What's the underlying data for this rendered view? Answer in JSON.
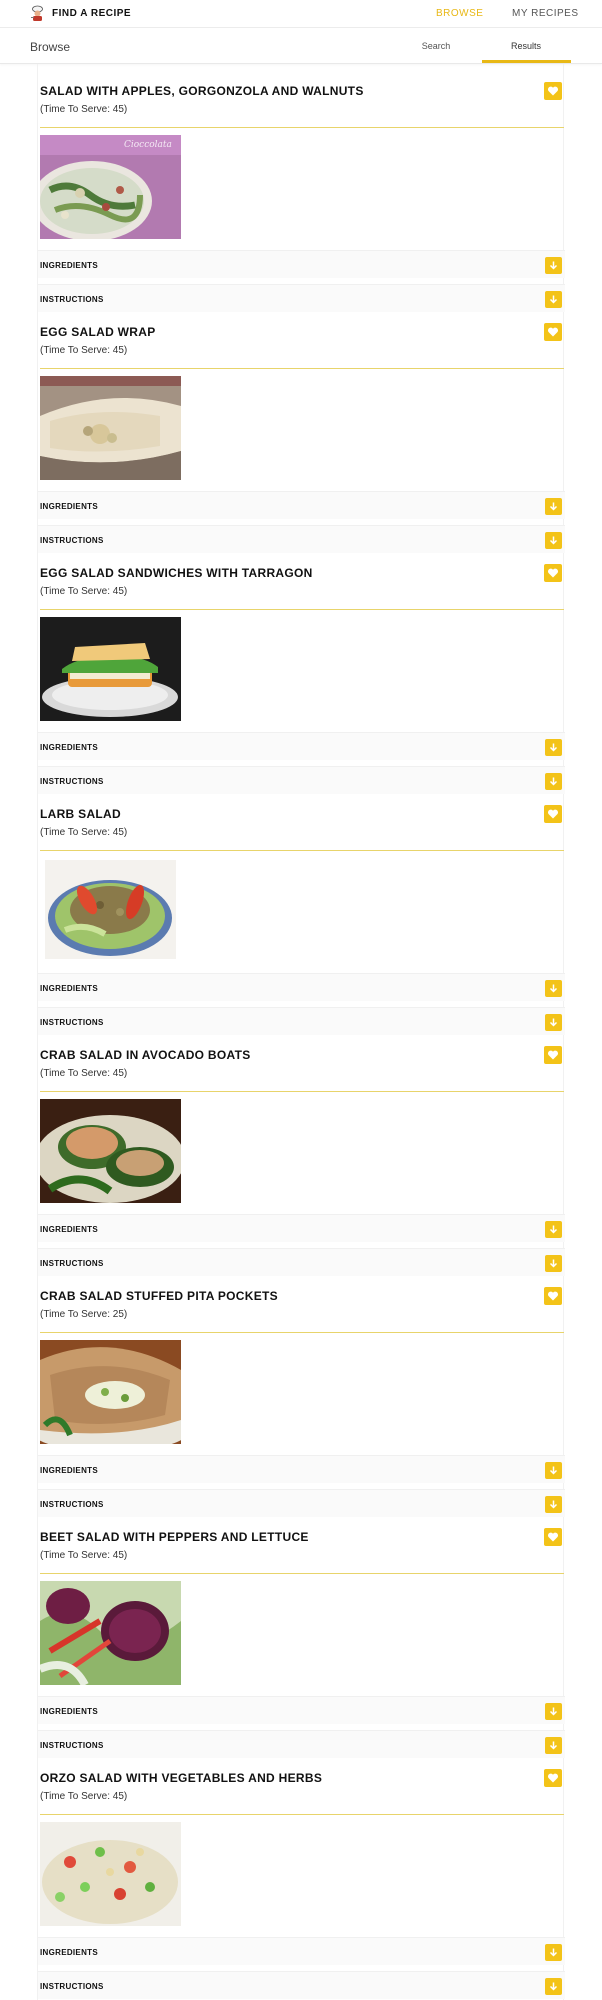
{
  "app": {
    "brand": "FIND A RECIPE",
    "logo_icon": "chef-icon"
  },
  "nav": {
    "browse": "BROWSE",
    "my_recipes": "MY RECIPES"
  },
  "subheader": {
    "title": "Browse",
    "tabs": [
      {
        "label": "Search",
        "active": false
      },
      {
        "label": "Results",
        "active": true
      }
    ]
  },
  "colors": {
    "accent": "#f3c318",
    "active_nav": "#e8b816",
    "divider": "#e8d46b"
  },
  "recipes": [
    {
      "title": "SALAD WITH APPLES, GORGONZOLA AND WALNUTS",
      "serve": "(Time To Serve: 45)",
      "ingredients_label": "INGREDIENTS",
      "instructions_label": "INSTRUCTIONS"
    },
    {
      "title": "EGG SALAD WRAP",
      "serve": "(Time To Serve: 45)",
      "ingredients_label": "INGREDIENTS",
      "instructions_label": "INSTRUCTIONS"
    },
    {
      "title": "EGG SALAD SANDWICHES WITH TARRAGON",
      "serve": "(Time To Serve: 45)",
      "ingredients_label": "INGREDIENTS",
      "instructions_label": "INSTRUCTIONS"
    },
    {
      "title": "LARB SALAD",
      "serve": "(Time To Serve: 45)",
      "ingredients_label": "INGREDIENTS",
      "instructions_label": "INSTRUCTIONS"
    },
    {
      "title": "CRAB SALAD IN AVOCADO BOATS",
      "serve": "(Time To Serve: 45)",
      "ingredients_label": "INGREDIENTS",
      "instructions_label": "INSTRUCTIONS"
    },
    {
      "title": "CRAB SALAD STUFFED PITA POCKETS",
      "serve": "(Time To Serve: 25)",
      "ingredients_label": "INGREDIENTS",
      "instructions_label": "INSTRUCTIONS"
    },
    {
      "title": "BEET SALAD WITH PEPPERS AND LETTUCE",
      "serve": "(Time To Serve: 45)",
      "ingredients_label": "INGREDIENTS",
      "instructions_label": "INSTRUCTIONS"
    },
    {
      "title": "ORZO SALAD WITH VEGETABLES AND HERBS",
      "serve": "(Time To Serve: 45)",
      "ingredients_label": "INGREDIENTS",
      "instructions_label": "INSTRUCTIONS"
    }
  ]
}
